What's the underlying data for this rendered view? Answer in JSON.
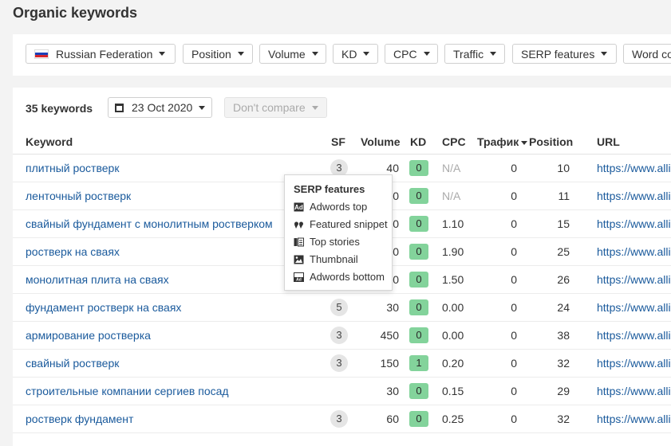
{
  "page": {
    "title": "Organic keywords"
  },
  "filters": {
    "country": "Russian Federation",
    "position": "Position",
    "volume": "Volume",
    "kd": "KD",
    "cpc": "CPC",
    "traffic": "Traffic",
    "serp_features": "SERP features",
    "word_count": "Word co"
  },
  "summary": {
    "count": "35 keywords",
    "date": "23 Oct 2020",
    "compare": "Don't compare"
  },
  "columns": {
    "keyword": "Keyword",
    "sf": "SF",
    "volume": "Volume",
    "kd": "KD",
    "cpc": "CPC",
    "traffic": "Трафик",
    "position": "Position",
    "url": "URL"
  },
  "rows": [
    {
      "keyword": "плитный ростверк",
      "sf": "3",
      "volume": "40",
      "kd": "0",
      "cpc": "N/A",
      "traffic": "0",
      "position": "10",
      "url": "https://www.allia"
    },
    {
      "keyword": "ленточный ростверк",
      "sf": "",
      "volume": "0",
      "kd": "0",
      "cpc": "N/A",
      "traffic": "0",
      "position": "11",
      "url": "https://www.allia"
    },
    {
      "keyword": "свайный фундамент с монолитным ростверком",
      "sf": "",
      "volume": "0",
      "kd": "0",
      "cpc": "1.10",
      "traffic": "0",
      "position": "15",
      "url": "https://www.allia"
    },
    {
      "keyword": "ростверк на сваях",
      "sf": "",
      "volume": "0",
      "kd": "0",
      "cpc": "1.90",
      "traffic": "0",
      "position": "25",
      "url": "https://www.allia"
    },
    {
      "keyword": "монолитная плита на сваях",
      "sf": "",
      "volume": "0",
      "kd": "0",
      "cpc": "1.50",
      "traffic": "0",
      "position": "26",
      "url": "https://www.allia"
    },
    {
      "keyword": "фундамент ростверк на сваях",
      "sf": "5",
      "volume": "30",
      "kd": "0",
      "cpc": "0.00",
      "traffic": "0",
      "position": "24",
      "url": "https://www.allia"
    },
    {
      "keyword": "армирование ростверка",
      "sf": "3",
      "volume": "450",
      "kd": "0",
      "cpc": "0.00",
      "traffic": "0",
      "position": "38",
      "url": "https://www.allia"
    },
    {
      "keyword": "свайный ростверк",
      "sf": "3",
      "volume": "150",
      "kd": "1",
      "cpc": "0.20",
      "traffic": "0",
      "position": "32",
      "url": "https://www.allia"
    },
    {
      "keyword": "строительные компании сергиев посад",
      "sf": "",
      "volume": "30",
      "kd": "0",
      "cpc": "0.15",
      "traffic": "0",
      "position": "29",
      "url": "https://www.allia"
    },
    {
      "keyword": "ростверк фундамент",
      "sf": "3",
      "volume": "60",
      "kd": "0",
      "cpc": "0.25",
      "traffic": "0",
      "position": "32",
      "url": "https://www.allia"
    }
  ],
  "tooltip": {
    "title": "SERP features",
    "items": [
      "Adwords top",
      "Featured snippet",
      "Top stories",
      "Thumbnail",
      "Adwords bottom"
    ]
  }
}
